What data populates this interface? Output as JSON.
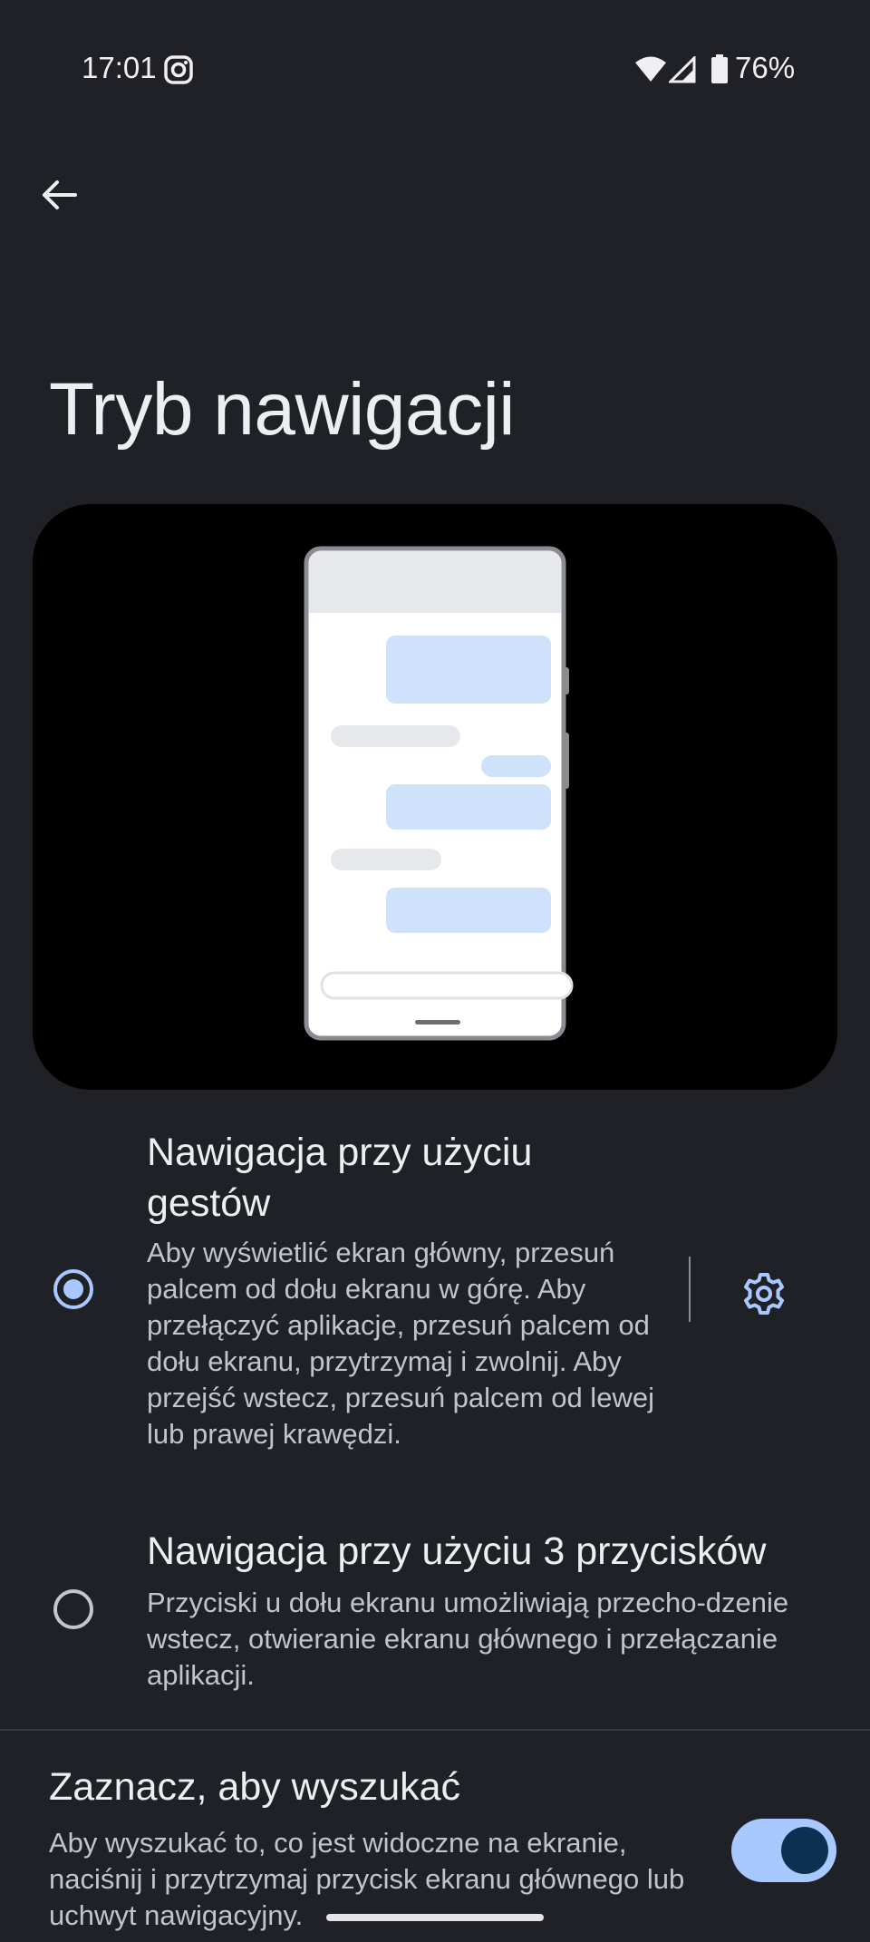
{
  "status_bar": {
    "time": "17:01",
    "battery": "76%"
  },
  "header": {
    "title": "Tryb nawigacji"
  },
  "options": {
    "gesture": {
      "title": "Nawigacja przy użyciu gestów",
      "description": "Aby wyświetlić ekran główny, przesuń palcem od dołu ekranu w górę. Aby przełączyć aplikacje, przesuń palcem od dołu ekranu, przytrzymaj i zwolnij. Aby przejść wstecz, przesuń palcem od lewej lub prawej krawędzi.",
      "selected": true
    },
    "three_button": {
      "title": "Nawigacja przy użyciu 3 przycisków",
      "description": "Przyciski u dołu ekranu umożliwiają przecho-dzenie wstecz, otwieranie ekranu głównego i przełączanie aplikacji.",
      "selected": false
    }
  },
  "search": {
    "title": "Zaznacz, aby wyszukać",
    "description": "Aby wyszukać to, co jest widoczne na ekranie, naciśnij i przytrzymaj przycisk ekranu głównego lub uchwyt nawigacyjny.",
    "enabled": true
  },
  "colors": {
    "background": "#1f2126",
    "accent": "#a8c8ff",
    "toggle_thumb": "#0b3050"
  },
  "icons": [
    "instagram-icon",
    "wifi-icon",
    "signal-icon",
    "battery-icon",
    "back-arrow-icon",
    "gear-icon"
  ]
}
